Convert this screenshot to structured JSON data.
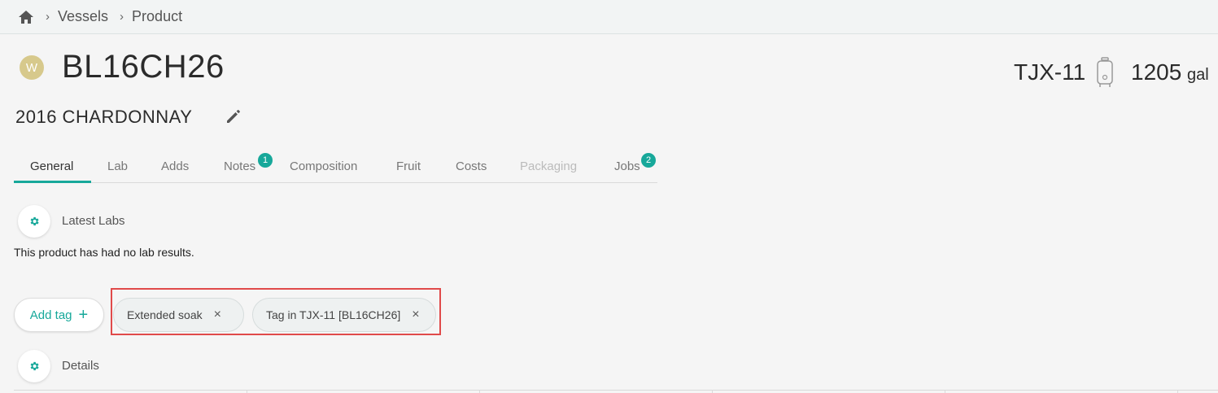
{
  "breadcrumb": {
    "items": [
      "Vessels",
      "Product"
    ],
    "separator": "›"
  },
  "header": {
    "avatar_letter": "W",
    "lot_code": "BL16CH26",
    "vessel_id": "TJX-11",
    "volume": "1205",
    "unit": "gal",
    "wine_name": "2016 CHARDONNAY"
  },
  "tabs": [
    {
      "label": "General",
      "state": "active"
    },
    {
      "label": "Lab",
      "state": "normal"
    },
    {
      "label": "Adds",
      "state": "normal"
    },
    {
      "label": "Notes",
      "state": "normal",
      "badge": "1"
    },
    {
      "label": "Composition",
      "state": "normal"
    },
    {
      "label": "Fruit",
      "state": "normal"
    },
    {
      "label": "Costs",
      "state": "normal"
    },
    {
      "label": "Packaging",
      "state": "disabled"
    },
    {
      "label": "Jobs",
      "state": "normal",
      "badge": "2"
    }
  ],
  "latest_labs": {
    "title": "Latest Labs",
    "empty_message": "This product has had no lab results."
  },
  "tags": {
    "add_label": "Add tag",
    "add_symbol": "+",
    "remove_symbol": "×",
    "items": [
      "Extended soak",
      "Tag in TJX-11 [BL16CH26]"
    ]
  },
  "details": {
    "title": "Details"
  },
  "colors": {
    "accent": "#17a89a",
    "avatar": "#d7c98c",
    "highlight": "#e04a4a"
  }
}
